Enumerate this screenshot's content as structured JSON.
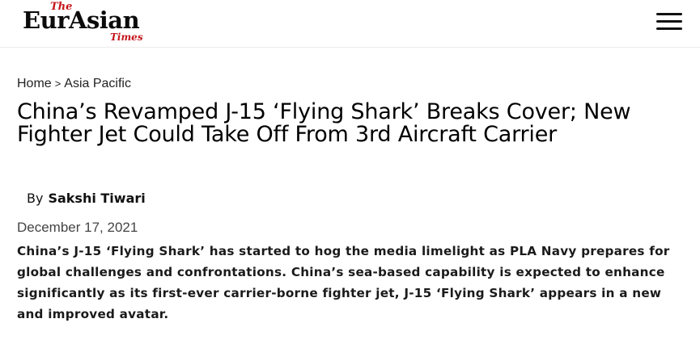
{
  "header": {
    "logo_the": "The",
    "logo_main": "EurAsian",
    "logo_times": "Times",
    "menu_icon": "hamburger-menu-icon"
  },
  "breadcrumb": {
    "home": "Home",
    "separator": ">",
    "category": "Asia Pacific"
  },
  "article": {
    "title": "China’s Revamped J-15 ‘Flying Shark’ Breaks Cover; New Fighter Jet Could Take Off From 3rd Aircraft Carrier",
    "by_label": "By",
    "author": "Sakshi Tiwari",
    "date": "December 17, 2021",
    "intro": "China’s J-15 ‘Flying Shark’ has started to hog the media limelight as PLA Navy prepares for global challenges and confrontations. China’s sea-based capability is expected to enhance significantly as its first-ever carrier-borne fighter jet, J-15 ‘Flying Shark’ appears in a new and improved avatar."
  },
  "colors": {
    "brand_red": "#c4161c",
    "text": "#111111",
    "background": "#ffffff"
  }
}
